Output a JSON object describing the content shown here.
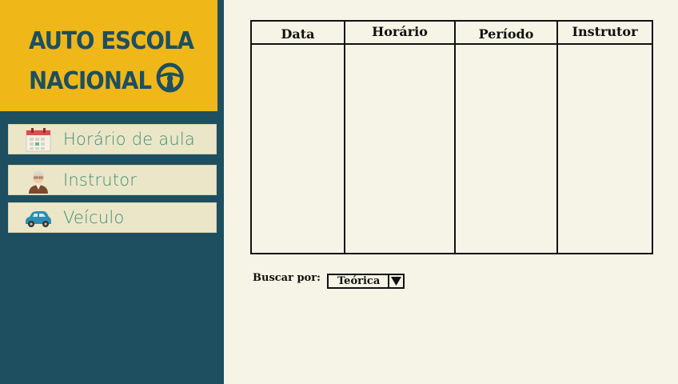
{
  "brand": {
    "line1": "AUTO ESCOLA",
    "line2": "NACIONAL"
  },
  "menu": [
    {
      "label": "Horário de aula",
      "icon": "calendar-icon"
    },
    {
      "label": "Instrutor",
      "icon": "instructor-icon"
    },
    {
      "label": "Veículo",
      "icon": "car-icon"
    }
  ],
  "table": {
    "columns": [
      "Data",
      "Horário",
      "Período",
      "Instrutor"
    ],
    "rows": []
  },
  "search": {
    "label": "Buscar por:",
    "selected": "Teórica"
  },
  "colors": {
    "sidebar": "#1d4f60",
    "header": "#f0b718",
    "menu_bg": "#ece6c8",
    "menu_text": "#3f8f78",
    "page_bg": "#f6f4e6"
  }
}
